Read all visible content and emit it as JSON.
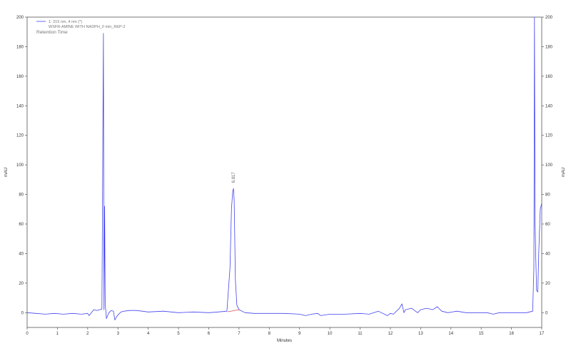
{
  "chart_data": {
    "type": "line",
    "xlabel": "Minutes",
    "ylabel_left": "mAU",
    "ylabel_right": "mAU",
    "xlim": [
      0,
      17
    ],
    "ylim": [
      -10,
      200
    ],
    "x_ticks": [
      0,
      1,
      2,
      3,
      4,
      5,
      6,
      7,
      8,
      9,
      10,
      11,
      12,
      13,
      14,
      15,
      16,
      17
    ],
    "y_ticks": [
      0,
      20,
      40,
      60,
      80,
      100,
      120,
      140,
      160,
      180,
      200
    ],
    "legend": {
      "entry": "1: 215 nm, 4 nm (*)",
      "series_name": "WSFR-AMINE WITH NADPH_0 min_REP-2",
      "subtitle": "Retention Time",
      "placement": "top-left"
    },
    "peak_label": {
      "text": "6.817",
      "x": 6.817,
      "y": 84
    },
    "series": [
      {
        "name": "WSFR-AMINE WITH NADPH_0 min_REP-2",
        "color": "#4444ee",
        "x": [
          0,
          0.3,
          0.6,
          0.9,
          1.2,
          1.5,
          1.8,
          2.0,
          2.05,
          2.2,
          2.3,
          2.4,
          2.47,
          2.52,
          2.54,
          2.56,
          2.58,
          2.6,
          2.62,
          2.66,
          2.7,
          2.78,
          2.85,
          2.9,
          2.95,
          3.0,
          3.1,
          3.2,
          3.4,
          3.6,
          3.8,
          4.0,
          4.5,
          5.0,
          5.5,
          6.0,
          6.3,
          6.6,
          6.7,
          6.75,
          6.79,
          6.817,
          6.84,
          6.88,
          6.93,
          7.0,
          7.2,
          7.5,
          8.0,
          8.5,
          9.0,
          9.2,
          9.4,
          9.6,
          9.7,
          10.0,
          10.5,
          11.0,
          11.3,
          11.6,
          11.9,
          12.0,
          12.1,
          12.2,
          12.3,
          12.38,
          12.45,
          12.5,
          12.7,
          12.9,
          13.0,
          13.2,
          13.4,
          13.55,
          13.6,
          13.7,
          13.9,
          14.2,
          14.5,
          14.9,
          15.2,
          15.4,
          15.6,
          15.9,
          16.2,
          16.5,
          16.7,
          16.74,
          16.76,
          16.78,
          16.8,
          16.83,
          16.87,
          16.9,
          16.95,
          17.0
        ],
        "y": [
          0,
          -0.5,
          -1,
          -0.5,
          -1,
          -0.5,
          -1,
          -0.5,
          -2,
          2,
          1.5,
          2,
          2.5,
          189,
          2,
          72,
          5,
          1,
          -4,
          -2,
          0,
          1.5,
          1,
          -5,
          -3,
          -1.5,
          0.5,
          1,
          1.5,
          1.5,
          1,
          0.5,
          1,
          0,
          0.5,
          0,
          0.5,
          1,
          30,
          70,
          82,
          84,
          76,
          22,
          5,
          2,
          0,
          -0.5,
          -0.5,
          -0.5,
          -1,
          -2,
          -1,
          -0.5,
          -2,
          -1,
          -1,
          -0.5,
          -1,
          1,
          -2,
          -0.5,
          -1,
          1,
          3,
          6,
          0,
          2,
          3,
          0,
          2,
          3,
          2,
          4,
          3,
          1,
          0,
          1,
          0,
          0,
          0,
          -1,
          0,
          0,
          0,
          0,
          1,
          30,
          200,
          60,
          40,
          15,
          14,
          40,
          70,
          74
        ]
      }
    ]
  }
}
